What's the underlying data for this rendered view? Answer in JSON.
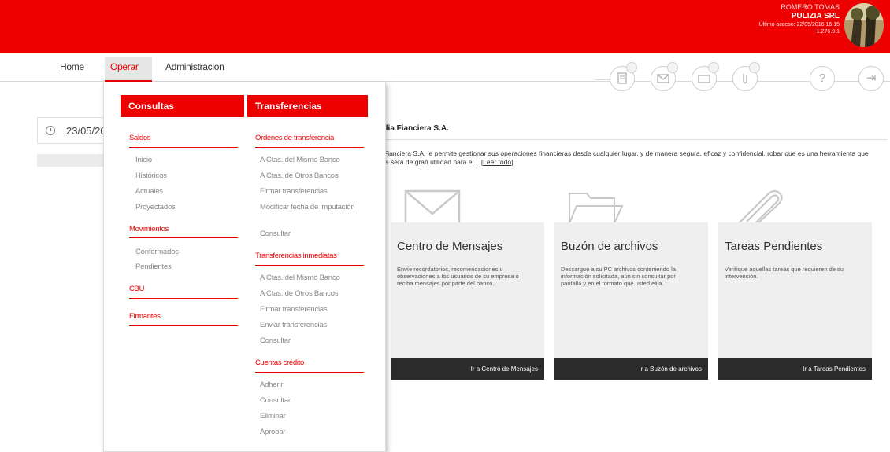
{
  "header": {
    "user_name": "ROMERO TOMAS",
    "company": "PULIZIA SRL",
    "last_access": "Último acceso: 22/05/2016 16:15",
    "user_id": "1.276.9.1",
    "brand_color": "#ec0000"
  },
  "nav": {
    "home": "Home",
    "operar": "Operar",
    "administracion": "Administracion"
  },
  "toolbar": {
    "icons": [
      "document-icon",
      "mail-icon",
      "folder-icon",
      "attachment-icon",
      "help-icon",
      "logout-icon"
    ],
    "help_glyph": "?",
    "logout_glyph": "⇥"
  },
  "page": {
    "date": "23/05/20",
    "welcome_title": "ilia Fianciera S.A.",
    "welcome_text": "Fianciera S.A. le permite gestionar sus operaciones financieras desde cualquier lugar, y de manera segura, eficaz y confidencial. robar que es una herramienta que le será de gran utilidad para el...",
    "welcome_link": "[Leer todo]"
  },
  "cards": [
    {
      "title": "Centro de Mensajes",
      "desc": "Envíe recordatorios, recomendaciones u observaciones a los usuarios de su empresa o reciba mensajes por parte del banco.",
      "button": "Ir a Centro de Mensajes",
      "icon": "envelope-icon"
    },
    {
      "title": "Buzón de archivos",
      "desc": "Descargue a su PC archivos conteniendo la información solicitada, aún sin consultar por pantalla y en el formato que usted elija.",
      "button": "Ir a Buzón de archivos",
      "icon": "folder-icon"
    },
    {
      "title": "Tareas Pendientes",
      "desc": "Verifique aquellas tareas que requieren de su intervención.",
      "button": "Ir a Tareas Pendientes",
      "icon": "paperclip-icon"
    }
  ],
  "menu": {
    "consultas": {
      "header": "Consultas",
      "saldos": {
        "label": "Saldos",
        "items": [
          "Inicio",
          "Históricos",
          "Actuales",
          "Proyectados"
        ]
      },
      "movimientos": {
        "label": "Movimientos",
        "items": [
          "Conformados",
          "Pendientes"
        ]
      },
      "cbu": "CBU",
      "firmantes": "Firmantes"
    },
    "transferencias": {
      "header": "Transferencias",
      "ordenes": {
        "label": "Ordenes de transferencia",
        "items": [
          "A Ctas. del Mismo Banco",
          "A Ctas. de Otros Bancos",
          "Firmar transferencias",
          "Modificar fecha de imputación",
          "Consultar"
        ]
      },
      "inmediatas": {
        "label": "Transferencias inmediatas",
        "items": [
          "A Ctas. del Mismo Banco",
          "A Ctas. de Otros Bancos",
          "Firmar transferencias",
          "Enviar transferencias",
          "Consultar"
        ]
      },
      "credito": {
        "label": "Cuentas crédito",
        "items": [
          "Adherir",
          "Consultar",
          "Eliminar",
          "Aprobar"
        ]
      }
    }
  }
}
